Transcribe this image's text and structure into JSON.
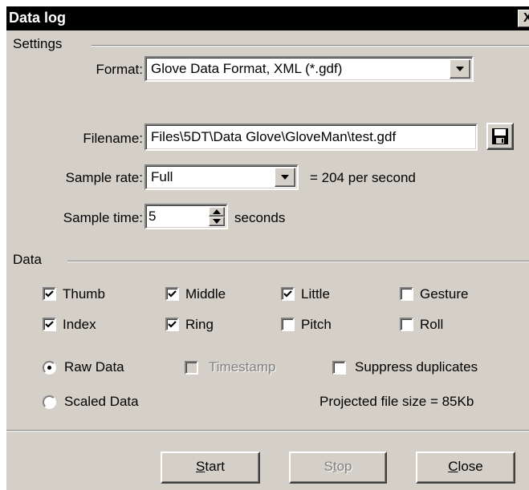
{
  "window": {
    "title": "Data log",
    "close_glyph": "X"
  },
  "settings": {
    "group_label": "Settings",
    "format": {
      "label": "Format:",
      "value": "Glove Data Format, XML (*.gdf)"
    },
    "filename": {
      "label": "Filename:",
      "value": "Files\\5DT\\Data Glove\\GloveMan\\test.gdf",
      "icon": "save-icon"
    },
    "sample_rate": {
      "label": "Sample rate:",
      "value": "Full",
      "note": "= 204 per second"
    },
    "sample_time": {
      "label": "Sample time:",
      "value": "5",
      "unit": "seconds"
    }
  },
  "data": {
    "group_label": "Data",
    "checkboxes": [
      {
        "label": "Thumb",
        "checked": true
      },
      {
        "label": "Middle",
        "checked": true
      },
      {
        "label": "Little",
        "checked": true
      },
      {
        "label": "Gesture",
        "checked": false
      },
      {
        "label": "Index",
        "checked": true
      },
      {
        "label": "Ring",
        "checked": true
      },
      {
        "label": "Pitch",
        "checked": false
      },
      {
        "label": "Roll",
        "checked": false
      }
    ],
    "raw_data": {
      "label": "Raw Data",
      "selected": true
    },
    "scaled_data": {
      "label": "Scaled Data",
      "selected": false
    },
    "timestamp": {
      "label": "Timestamp",
      "checked": false,
      "disabled": true
    },
    "suppress_duplicates": {
      "label": "Suppress duplicates",
      "checked": false
    },
    "projected_size": "Projected file size = 85Kb"
  },
  "buttons": {
    "start": {
      "mnemonic": "S",
      "rest": "tart"
    },
    "stop": {
      "first": "S",
      "mnemonic": "t",
      "rest": "op"
    },
    "close": {
      "mnemonic": "C",
      "rest": "lose"
    }
  }
}
